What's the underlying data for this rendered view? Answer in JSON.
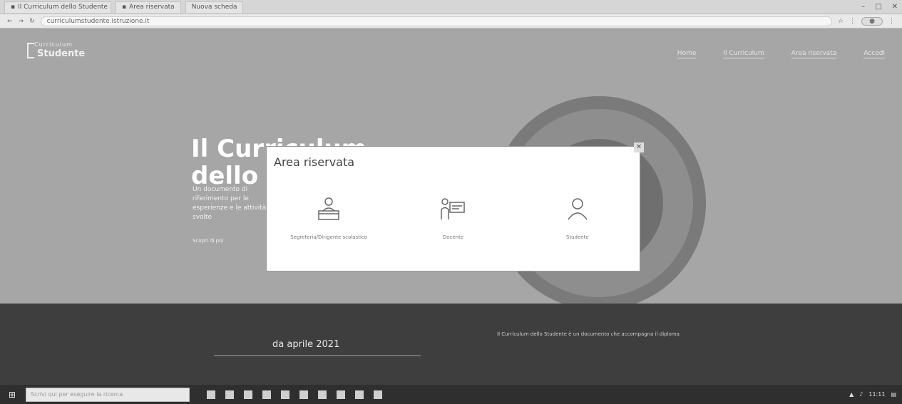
{
  "browser": {
    "tabs": [
      {
        "label": "Il Curriculum dello Studente"
      },
      {
        "label": "Area riservata"
      },
      {
        "label": "Nuova scheda"
      }
    ],
    "url": "curriculumstudente.istruzione.it"
  },
  "site": {
    "logo_line1": "Curriculum",
    "logo_line2": "Studente",
    "nav": [
      "Home",
      "Il Curriculum",
      "Area riservata",
      "Accedi"
    ]
  },
  "hero": {
    "title_line1": "Il Curriculum",
    "title_line2": "dello Studente",
    "text": "Un documento di riferimento per le esperienze e le attività svolte",
    "cta": "Scopri di più"
  },
  "band": {
    "date_title": "da aprile 2021",
    "right_text": "Il Curriculum dello Studente è un documento che accompagna il diploma"
  },
  "modal": {
    "title": "Area riservata",
    "options": [
      {
        "label": "Segreteria/Dirigente scolastico",
        "icon": "desk-person-icon"
      },
      {
        "label": "Docente",
        "icon": "presentation-board-icon"
      },
      {
        "label": "Studente",
        "icon": "user-icon"
      }
    ]
  },
  "taskbar": {
    "search_placeholder": "Scrivi qui per eseguire la ricerca",
    "time": "11:11"
  }
}
